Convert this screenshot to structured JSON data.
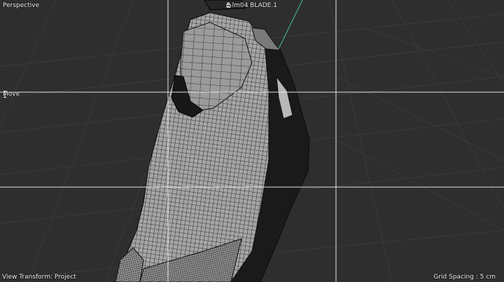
{
  "viewport": {
    "view_name": "Perspective",
    "object_label": "1 lm04 BLADE.1",
    "tool_name": "Move",
    "view_transform": "View Transform: Project",
    "grid_spacing": "Grid Spacing : 5 cm"
  },
  "icons": {
    "object_lock": "lock-icon",
    "tool_cursor": "text-cursor-icon",
    "snap": "snap-icon"
  },
  "colors": {
    "background": "#2e2e2e",
    "grid": "#3b3b3b",
    "guide": "#e6e6e6",
    "mesh_fill": "#a9a9a9",
    "mesh_wire": "#111111",
    "axis": "#3fbf9f"
  }
}
